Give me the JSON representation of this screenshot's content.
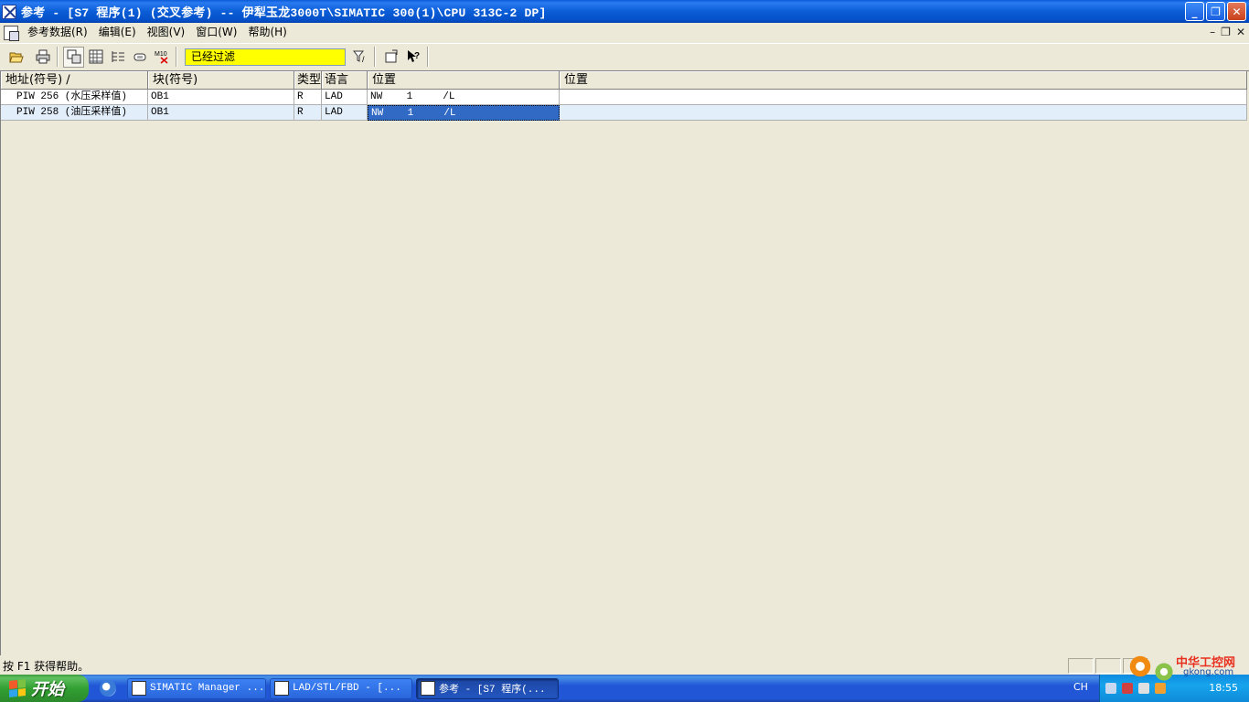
{
  "window": {
    "title": "参考 - [S7 程序(1) (交叉参考) -- 伊犁玉龙3000T\\SIMATIC 300(1)\\CPU 313C-2 DP]",
    "minimize": "_",
    "restore": "❐",
    "close": "✕"
  },
  "menu": {
    "items": [
      "参考数据(R)",
      "编辑(E)",
      "视图(V)",
      "窗口(W)",
      "帮助(H)"
    ],
    "mdi_buttons": [
      "–",
      "❐",
      "✕"
    ]
  },
  "toolbar": {
    "filter_text": "已经过滤",
    "icons": [
      "open-icon",
      "print-icon",
      "cross-reference-icon",
      "assignment-icon",
      "program-structure-icon",
      "unused-symbols-icon",
      "m10-no-symbol-icon",
      "filter-icon",
      "go-to-location-icon",
      "context-help-icon"
    ]
  },
  "table": {
    "headers": [
      "地址(符号) ∕",
      "块(符号)",
      "类型",
      "语言",
      "位置",
      "位置"
    ],
    "rows": [
      [
        "PIW 256 (水压采样值)",
        "OB1",
        "R",
        "LAD",
        "NW    1     /L",
        ""
      ],
      [
        "PIW 258 (油压采样值)",
        "OB1",
        "R",
        "LAD",
        "NW    1     /L",
        ""
      ]
    ],
    "selected_cell": {
      "row": 1,
      "col": 4
    }
  },
  "status": {
    "text": "按 F1 获得帮助。"
  },
  "taskbar": {
    "start_label": "开始",
    "tasks": [
      "SIMATIC Manager ...",
      "LAD/STL/FBD  - [...",
      "参考 - [S7 程序(..."
    ],
    "active_task": 2,
    "language": "CH",
    "clock": "18:55"
  },
  "watermark": {
    "site": "中华工控网",
    "url": "gkong.com"
  },
  "colors": {
    "titlebar": "#0b5ed7",
    "filter_bg": "#ffff00",
    "selection": "#316ac5",
    "alt_row": "#e3eefb"
  }
}
